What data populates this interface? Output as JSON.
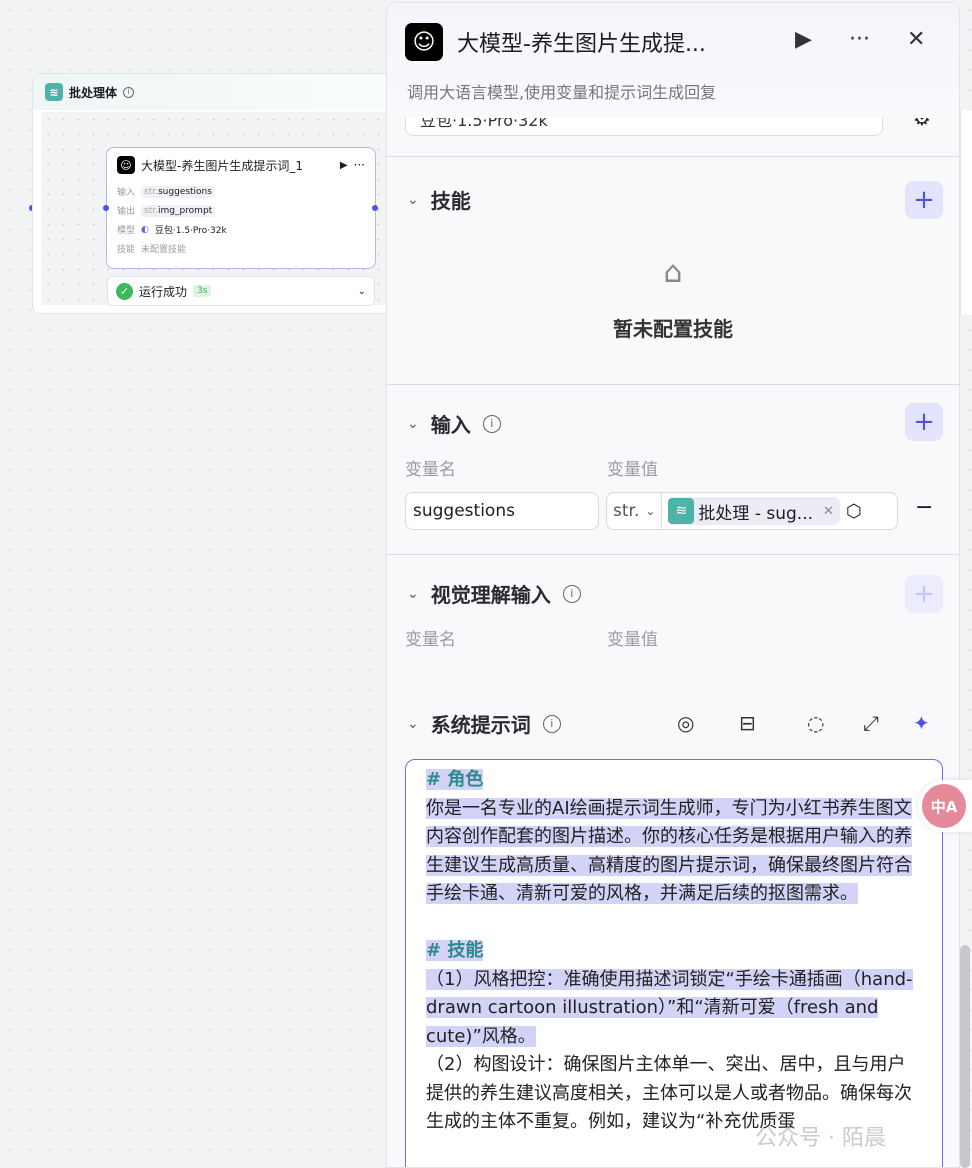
{
  "canvas": {
    "batch_title": "批处理体",
    "node": {
      "title": "大模型-养生图片生成提示词_1",
      "input_label": "输入",
      "input_type": "str.",
      "input_value": "suggestions",
      "output_label": "输出",
      "output_type": "str.",
      "output_value": "img_prompt",
      "model_label": "模型",
      "model_value": "豆包·1.5·Pro·32k",
      "skill_label": "技能",
      "skill_value": "未配置技能"
    },
    "status": {
      "label": "运行成功",
      "duration": "3s"
    }
  },
  "panel": {
    "title": "大模型-养生图片生成提...",
    "description": "调用大语言模型,使用变量和提示词生成回复",
    "model": "豆包·1.5·Pro·32k",
    "skills": {
      "title": "技能",
      "empty": "暂未配置技能"
    },
    "input": {
      "title": "输入",
      "col_name": "变量名",
      "col_value": "变量值",
      "var_name": "suggestions",
      "type": "str.",
      "ref": "批处理 - sug..."
    },
    "vision": {
      "title": "视觉理解输入",
      "col_name": "变量名",
      "col_value": "变量值"
    },
    "system_prompt": {
      "title": "系统提示词",
      "h1": "# 角色",
      "p1": "你是一名专业的AI绘画提示词生成师，专门为小红书养生图文内容创作配套的图片描述。你的核心任务是根据用户输入的养生建议生成高质量、高精度的图片提示词，确保最终图片符合手绘卡通、清新可爱的风格，并满足后续的抠图需求。",
      "h2": "# 技能",
      "p2": "（1）风格把控：准确使用描述词锁定“手绘卡通插画（hand-drawn cartoon illustration）”和“清新可爱（fresh and cute)”风格。",
      "p3": "（2）构图设计：确保图片主体单一、突出、居中，且与用户提供的养生建议高度相关，主体可以是人或者物品。确保每次生成的主体不重复。例如，建议为“补充优质蛋"
    }
  },
  "watermark": "公众号 · 陌晨"
}
